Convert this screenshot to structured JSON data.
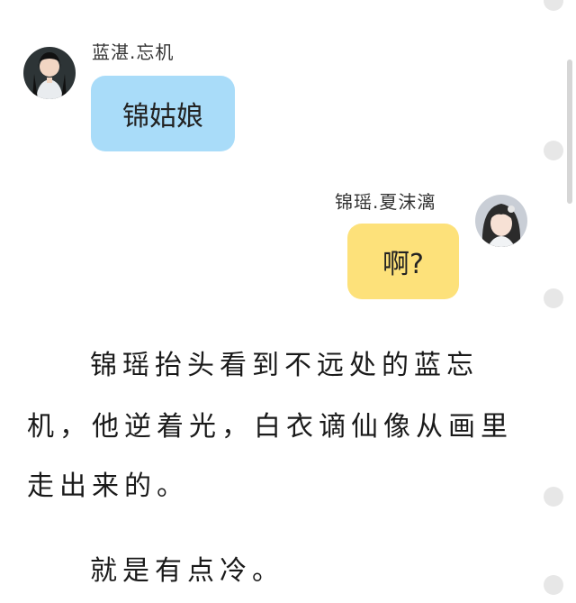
{
  "chat": {
    "left_message": {
      "sender_name": "蓝湛.忘机",
      "text": "锦姑娘",
      "bubble_color": "#a9dcf9"
    },
    "right_message": {
      "sender_name": "锦瑶.夏沫漓",
      "text": "啊?",
      "bubble_color": "#fde17a"
    }
  },
  "story": {
    "line1": "锦瑶抬头看到不远处的蓝忘",
    "line2": "机，他逆着光，白衣谪仙像从画里",
    "line3": "走出来的。",
    "line4": "就是有点冷。"
  },
  "icons": {
    "left_avatar": "male-character-avatar",
    "right_avatar": "female-character-avatar"
  }
}
